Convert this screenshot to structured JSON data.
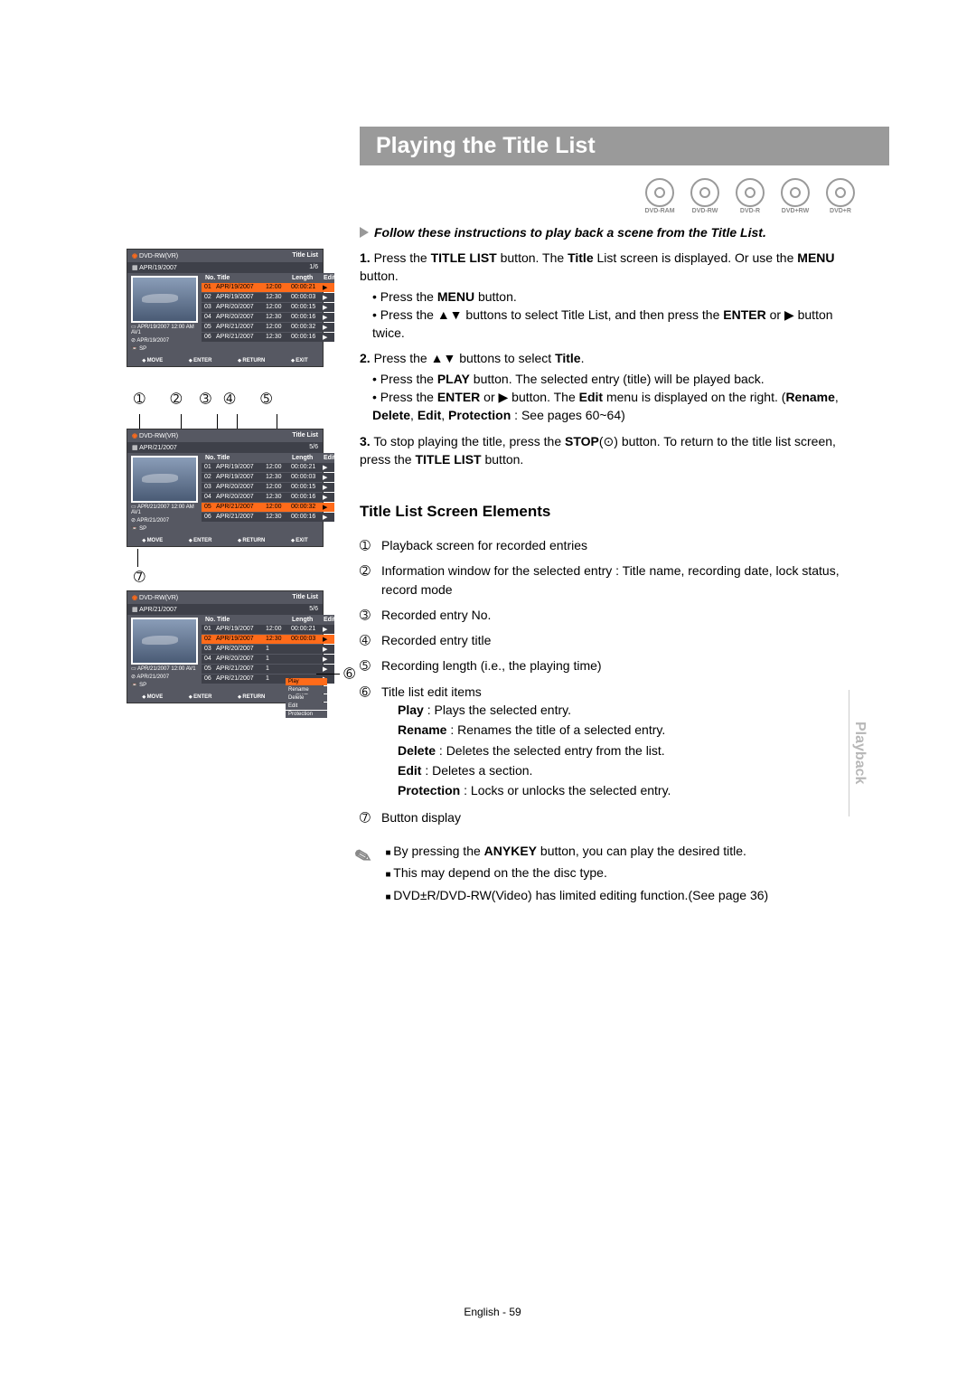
{
  "page": {
    "side_tab": "Playback",
    "title": "Playing the Title List",
    "discs": [
      "DVD-RAM",
      "DVD-RW",
      "DVD-R",
      "DVD+RW",
      "DVD+R"
    ],
    "instruction": "Follow these instructions to play back a scene from the Title List.",
    "steps": [
      {
        "num": "1.",
        "main": "Press the TITLE LIST button. The Title List screen is displayed. Or use the MENU button.",
        "subs": [
          "Press the MENU button.",
          "Press the ▲▼ buttons to select Title List, and then press the ENTER or ▶ button twice."
        ]
      },
      {
        "num": "2.",
        "main": "Press the ▲▼ buttons to select Title.",
        "subs": [
          "Press the PLAY button. The selected entry (title) will be played back.",
          "Press the ENTER or ▶ button. The Edit menu is displayed on the right. (Rename, Delete, Edit, Protection : See pages 60~64)"
        ]
      },
      {
        "num": "3.",
        "main": "To stop playing the title, press the STOP(⊙) button. To return to the title list screen, press the TITLE LIST button.",
        "subs": []
      }
    ],
    "elements_title": "Title List Screen Elements",
    "elements": [
      {
        "n": "➀",
        "text": "Playback screen for recorded entries"
      },
      {
        "n": "➁",
        "text": "Information window for the selected entry : Title name, recording date, lock status, record mode"
      },
      {
        "n": "➂",
        "text": "Recorded entry No."
      },
      {
        "n": "➃",
        "text": "Recorded entry title"
      },
      {
        "n": "➄",
        "text": "Recording length (i.e., the playing time)"
      },
      {
        "n": "➅",
        "text": "Title list edit items"
      },
      {
        "n": "➆",
        "text": "Button display"
      }
    ],
    "edit_items": [
      {
        "label": "Play",
        "desc": ": Plays the selected entry."
      },
      {
        "label": "Rename",
        "desc": ": Renames the title of a selected entry."
      },
      {
        "label": "Delete",
        "desc": ": Deletes the selected entry from the list."
      },
      {
        "label": "Edit",
        "desc": ": Deletes a section."
      },
      {
        "label": "Protection",
        "desc": ": Locks or unlocks the selected entry."
      }
    ],
    "notes": [
      "By pressing the ANYKEY button, you can play the desired title.",
      "This may depend on the the disc type.",
      "DVD±R/DVD-RW(Video) has limited editing function.(See page 36)"
    ],
    "footer": "English - 59"
  },
  "callouts": {
    "c1": "➀",
    "c2": "➁",
    "c3": "➂",
    "c4": "➃",
    "c5": "➄",
    "c6": "➅",
    "c7": "➆"
  },
  "screenshots": {
    "disc_label": "DVD-RW(VR)",
    "title_label": "Title List",
    "hdr_no": "No.",
    "hdr_title": "Title",
    "hdr_len": "Length",
    "hdr_edit": "Edit",
    "foot_move": "MOVE",
    "foot_enter": "ENTER",
    "foot_return": "RETURN",
    "foot_exit": "EXIT",
    "s1": {
      "date": "APR/19/2007",
      "page": "1/6",
      "info1": "APR/19/2007 12:00 AM AV1",
      "info2": "APR/19/2007",
      "info3": "SP",
      "rows": [
        {
          "n": "01",
          "t": "APR/19/2007",
          "tm": "12:00",
          "l": "00:00:21",
          "sel": true
        },
        {
          "n": "02",
          "t": "APR/19/2007",
          "tm": "12:30",
          "l": "00:00:03",
          "sel": false
        },
        {
          "n": "03",
          "t": "APR/20/2007",
          "tm": "12:00",
          "l": "00:00:15",
          "sel": false
        },
        {
          "n": "04",
          "t": "APR/20/2007",
          "tm": "12:30",
          "l": "00:00:16",
          "sel": false
        },
        {
          "n": "05",
          "t": "APR/21/2007",
          "tm": "12:00",
          "l": "00:00:32",
          "sel": false
        },
        {
          "n": "06",
          "t": "APR/21/2007",
          "tm": "12:30",
          "l": "00:00:16",
          "sel": false
        }
      ]
    },
    "s2": {
      "date": "APR/21/2007",
      "page": "5/6",
      "info1": "APR/21/2007 12:00 AM AV1",
      "info2": "APR/21/2007",
      "info3": "SP",
      "rows": [
        {
          "n": "01",
          "t": "APR/19/2007",
          "tm": "12:00",
          "l": "00:00:21",
          "sel": false
        },
        {
          "n": "02",
          "t": "APR/19/2007",
          "tm": "12:30",
          "l": "00:00:03",
          "sel": false
        },
        {
          "n": "03",
          "t": "APR/20/2007",
          "tm": "12:00",
          "l": "00:00:15",
          "sel": false
        },
        {
          "n": "04",
          "t": "APR/20/2007",
          "tm": "12:30",
          "l": "00:00:16",
          "sel": false
        },
        {
          "n": "05",
          "t": "APR/21/2007",
          "tm": "12:00",
          "l": "00:00:32",
          "sel": true
        },
        {
          "n": "06",
          "t": "APR/21/2007",
          "tm": "12:30",
          "l": "00:00:16",
          "sel": false
        }
      ]
    },
    "s3": {
      "date": "APR/21/2007",
      "page": "5/6",
      "info1": "APR/21/2007 12:00 AV1",
      "info2": "APR/21/2007",
      "info3": "SP",
      "rows": [
        {
          "n": "01",
          "t": "APR/19/2007",
          "tm": "12:00",
          "l": "00:00:21",
          "sel": false
        },
        {
          "n": "02",
          "t": "APR/19/2007",
          "tm": "12:30",
          "l": "00:00:03",
          "sel": true
        },
        {
          "n": "03",
          "t": "APR/20/2007",
          "tm": "1",
          "l": "",
          "sel": false
        },
        {
          "n": "04",
          "t": "APR/20/2007",
          "tm": "1",
          "l": "",
          "sel": false
        },
        {
          "n": "05",
          "t": "APR/21/2007",
          "tm": "1",
          "l": "",
          "sel": false
        },
        {
          "n": "06",
          "t": "APR/21/2007",
          "tm": "1",
          "l": "",
          "sel": false
        }
      ],
      "menu": [
        {
          "label": "Play",
          "sel": true
        },
        {
          "label": "Rename",
          "sel": false
        },
        {
          "label": "Delete",
          "sel": false
        },
        {
          "label": "Edit",
          "sel": false
        },
        {
          "label": "Protection",
          "sel": false
        }
      ]
    }
  }
}
